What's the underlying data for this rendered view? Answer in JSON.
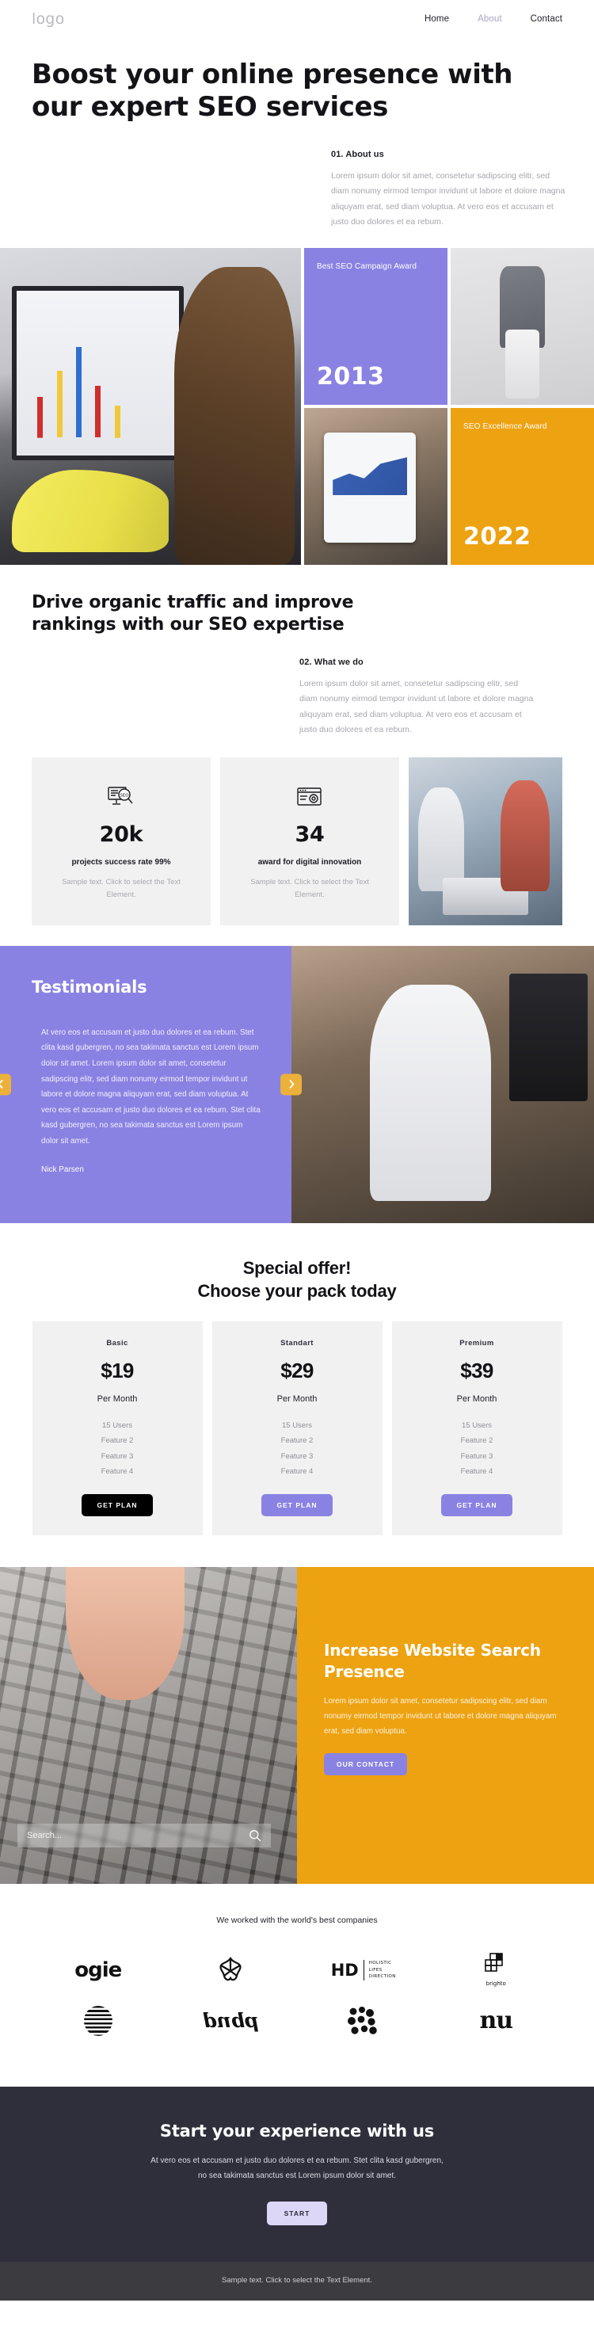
{
  "header": {
    "logo": "logo",
    "nav": [
      {
        "label": "Home",
        "muted": false
      },
      {
        "label": "About",
        "muted": true
      },
      {
        "label": "Contact",
        "muted": false
      }
    ]
  },
  "hero": {
    "title": "Boost your online presence with our expert SEO services",
    "eyebrow": "01. About us",
    "paragraph": "Lorem ipsum dolor sit amet, consetetur sadipscing elitr, sed diam nonumy eirmod tempor invidunt ut labore et dolore magna aliquyam erat, sed diam voluptua. At vero eos et accusam et justo duo dolores et ea rebum."
  },
  "awards": [
    {
      "title": "Best SEO Campaign Award",
      "year": "2013",
      "color": "#8a82e2"
    },
    {
      "title": "SEO Excellence Award",
      "year": "2022",
      "color": "#eda211"
    }
  ],
  "section2": {
    "title": "Drive organic traffic and improve rankings with our SEO expertise",
    "eyebrow": "02. What we do",
    "paragraph": "Lorem ipsum dolor sit amet, consetetur sadipscing elitr, sed diam nonumy eirmod tempor invidunt ut labore et dolore magna aliquyam erat, sed diam voluptua. At vero eos et accusam et justo duo dolores et ea rebum.",
    "stats": [
      {
        "icon": "seo-search-icon",
        "number": "20k",
        "label": "projects success rate 99%",
        "sub": "Sample text. Click to select the Text Element."
      },
      {
        "icon": "browser-gear-icon",
        "number": "34",
        "label": "award for digital innovation",
        "sub": "Sample text. Click to select the Text Element."
      }
    ]
  },
  "testimonials": {
    "title": "Testimonials",
    "quote": "At vero eos et accusam et justo duo dolores et ea rebum. Stet clita kasd gubergren, no sea takimata sanctus est Lorem ipsum dolor sit amet. Lorem ipsum dolor sit amet, consetetur sadipscing elitr, sed diam nonumy eirmod tempor invidunt ut labore et dolore magna aliquyam erat, sed diam voluptua. At vero eos et accusam et justo duo dolores et ea rebum. Stet clita kasd gubergren, no sea takimata sanctus est Lorem ipsum dolor sit amet.",
    "author": "Nick Parsen",
    "prev_icon": "chevron-left-icon",
    "next_icon": "chevron-right-icon",
    "arrow_color": "#ebb13a"
  },
  "pricing": {
    "title_line1": "Special offer!",
    "title_line2": "Choose your pack today",
    "plans": [
      {
        "name": "Basic",
        "price": "$19",
        "period": "Per Month",
        "features": [
          "15 Users",
          "Feature 2",
          "Feature 3",
          "Feature 4"
        ],
        "button": "GET PLAN",
        "button_style": "dark"
      },
      {
        "name": "Standart",
        "price": "$29",
        "period": "Per Month",
        "features": [
          "15 Users",
          "Feature 2",
          "Feature 3",
          "Feature 4"
        ],
        "button": "GET PLAN",
        "button_style": "purple"
      },
      {
        "name": "Premium",
        "price": "$39",
        "period": "Per Month",
        "features": [
          "15 Users",
          "Feature 2",
          "Feature 3",
          "Feature 4"
        ],
        "button": "GET PLAN",
        "button_style": "purple"
      }
    ]
  },
  "promo": {
    "search_placeholder": "Search...",
    "search_value": "",
    "search_icon": "magnifier-icon",
    "title": "Increase Website Search Presence",
    "paragraph": "Lorem ipsum dolor sit amet, consetetur sadipscing elitr, sed diam nonumy eirmod tempor invidunt ut labore et dolore magna aliquyam erat, sed diam voluptua.",
    "button": "OUR CONTACT"
  },
  "clients": {
    "title": "We worked with the world's best companies",
    "logos": [
      {
        "name": "ogie-logo",
        "text": "ogie"
      },
      {
        "name": "flower-star-logo",
        "text": ""
      },
      {
        "name": "hd-holistic-lifes-direction-logo",
        "text": "HD",
        "sub": "HOLISTIC LIFES DIRECTION"
      },
      {
        "name": "brighto-logo",
        "text": "brighto"
      },
      {
        "name": "striped-circle-logo",
        "text": ""
      },
      {
        "name": "pbnd-script-logo",
        "text": ""
      },
      {
        "name": "dots-pattern-logo",
        "text": ""
      },
      {
        "name": "nu-serif-logo",
        "text": ""
      }
    ]
  },
  "footer": {
    "title": "Start your experience with us",
    "paragraph": "At vero eos et accusam et justo duo dolores et ea rebum. Stet clita kasd gubergren, no sea takimata sanctus est Lorem ipsum dolor sit amet.",
    "button": "START",
    "bottom_text": "Sample text. Click to select the Text Element."
  },
  "colors": {
    "purple": "#8a82e2",
    "orange": "#eda211",
    "dark": "#2f2f3c",
    "light_gray": "#f1f1f1"
  }
}
